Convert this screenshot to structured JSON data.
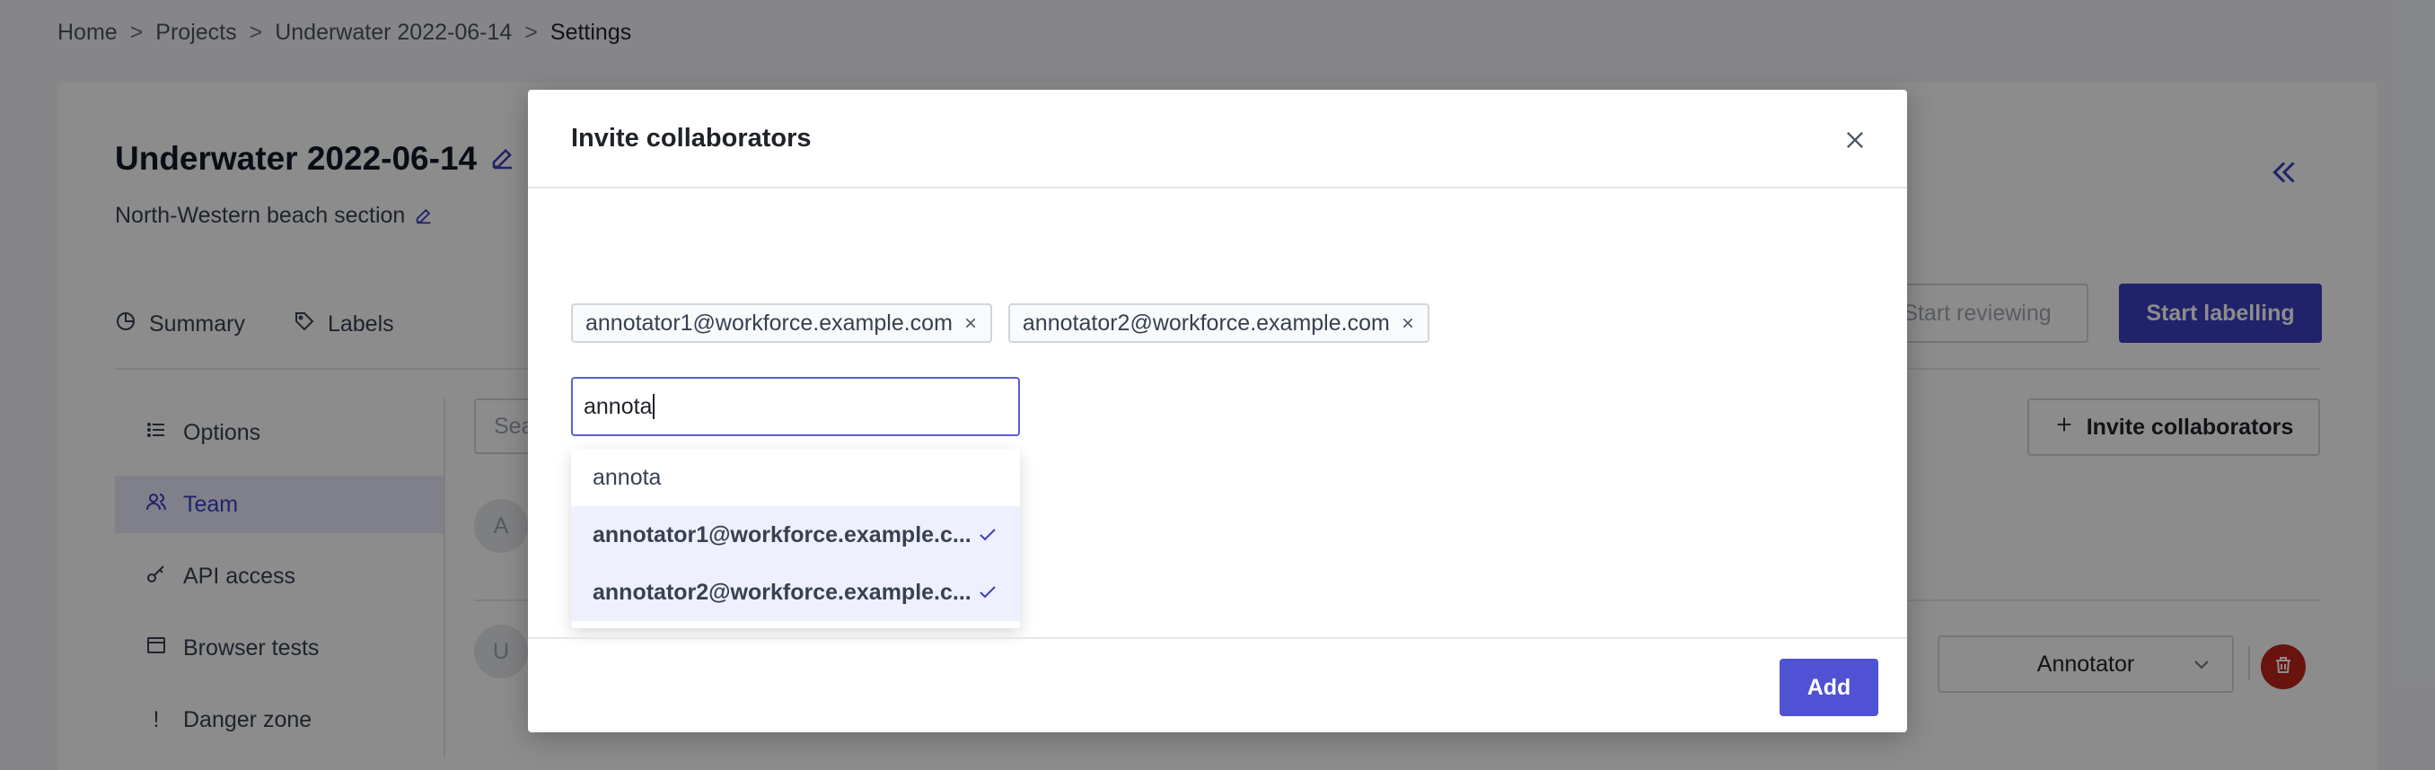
{
  "breadcrumb": {
    "items": [
      "Home",
      "Projects",
      "Underwater 2022-06-14",
      "Settings"
    ],
    "separator": ">"
  },
  "project": {
    "title": "Underwater 2022-06-14",
    "subtitle": "North-Western beach section"
  },
  "tabs": [
    {
      "label": "Summary",
      "icon": "pie-chart-icon"
    },
    {
      "label": "Labels",
      "icon": "tag-icon"
    }
  ],
  "actions": {
    "start_reviewing": "Start reviewing",
    "start_labelling": "Start labelling"
  },
  "side_menu": [
    {
      "label": "Options",
      "icon": "list-icon",
      "active": false
    },
    {
      "label": "Team",
      "icon": "team-icon",
      "active": true
    },
    {
      "label": "API access",
      "icon": "key-icon",
      "active": false
    },
    {
      "label": "Browser tests",
      "icon": "browser-icon",
      "active": false
    },
    {
      "label": "Danger zone",
      "icon": "exclamation-icon",
      "active": false
    }
  ],
  "team": {
    "search_placeholder": "Sea",
    "invite_button": "Invite collaborators",
    "members": [
      {
        "avatar": "A"
      },
      {
        "avatar": "U",
        "role": "Annotator"
      }
    ]
  },
  "modal": {
    "title": "Invite collaborators",
    "chips": [
      "annotator1@workforce.example.com",
      "annotator2@workforce.example.com"
    ],
    "input_value": "annota",
    "dropdown": [
      {
        "label": "annota",
        "selected": false
      },
      {
        "label": "annotator1@workforce.example.c...",
        "selected": true
      },
      {
        "label": "annotator2@workforce.example.c...",
        "selected": true
      }
    ],
    "add_button": "Add"
  },
  "colors": {
    "primary": "#3b3ec1",
    "danger": "#c0261c",
    "active_bg": "#e8eafc"
  }
}
